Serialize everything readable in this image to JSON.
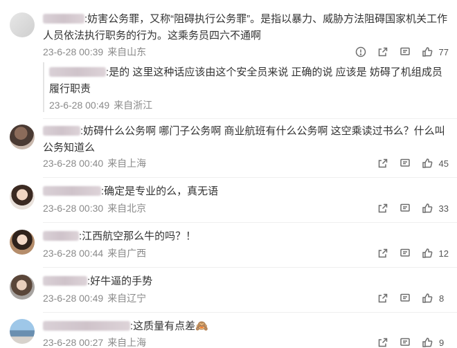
{
  "comments": [
    {
      "text": ":妨害公务罪，又称“阻碍执行公务罪”。是指以暴力、威胁方法阻碍国家机关工作人员依法执行职务的行为。这乘务员四六不通啊",
      "date": "23-6-28 00:39",
      "location": "来自山东",
      "likes": "77",
      "reply": {
        "text": ":是的 这里这种话应该由这个安全员来说 正确的说 应该是 妨碍了机组成员履行职责",
        "date": "23-6-28 00:49",
        "location": "来自浙江"
      }
    },
    {
      "text": ":妨碍什么公务啊 哪门子公务啊 商业航班有什么公务啊 这空乘读过书么？什么叫公务知道么",
      "date": "23-6-28 00:40",
      "location": "来自上海",
      "likes": "45"
    },
    {
      "text": ":确定是专业的么，真无语",
      "date": "23-6-28 00:30",
      "location": "来自北京",
      "likes": "33"
    },
    {
      "text": ":江西航空那么牛的吗？！",
      "date": "23-6-28 00:44",
      "location": "来自广西",
      "likes": "12"
    },
    {
      "text": ":好牛逼的手势",
      "date": "23-6-28 00:49",
      "location": "来自辽宁",
      "likes": "8"
    },
    {
      "text": ":这质量有点差",
      "emoji": "🙈",
      "date": "23-6-28 00:27",
      "location": "来自上海",
      "likes": "9"
    }
  ]
}
